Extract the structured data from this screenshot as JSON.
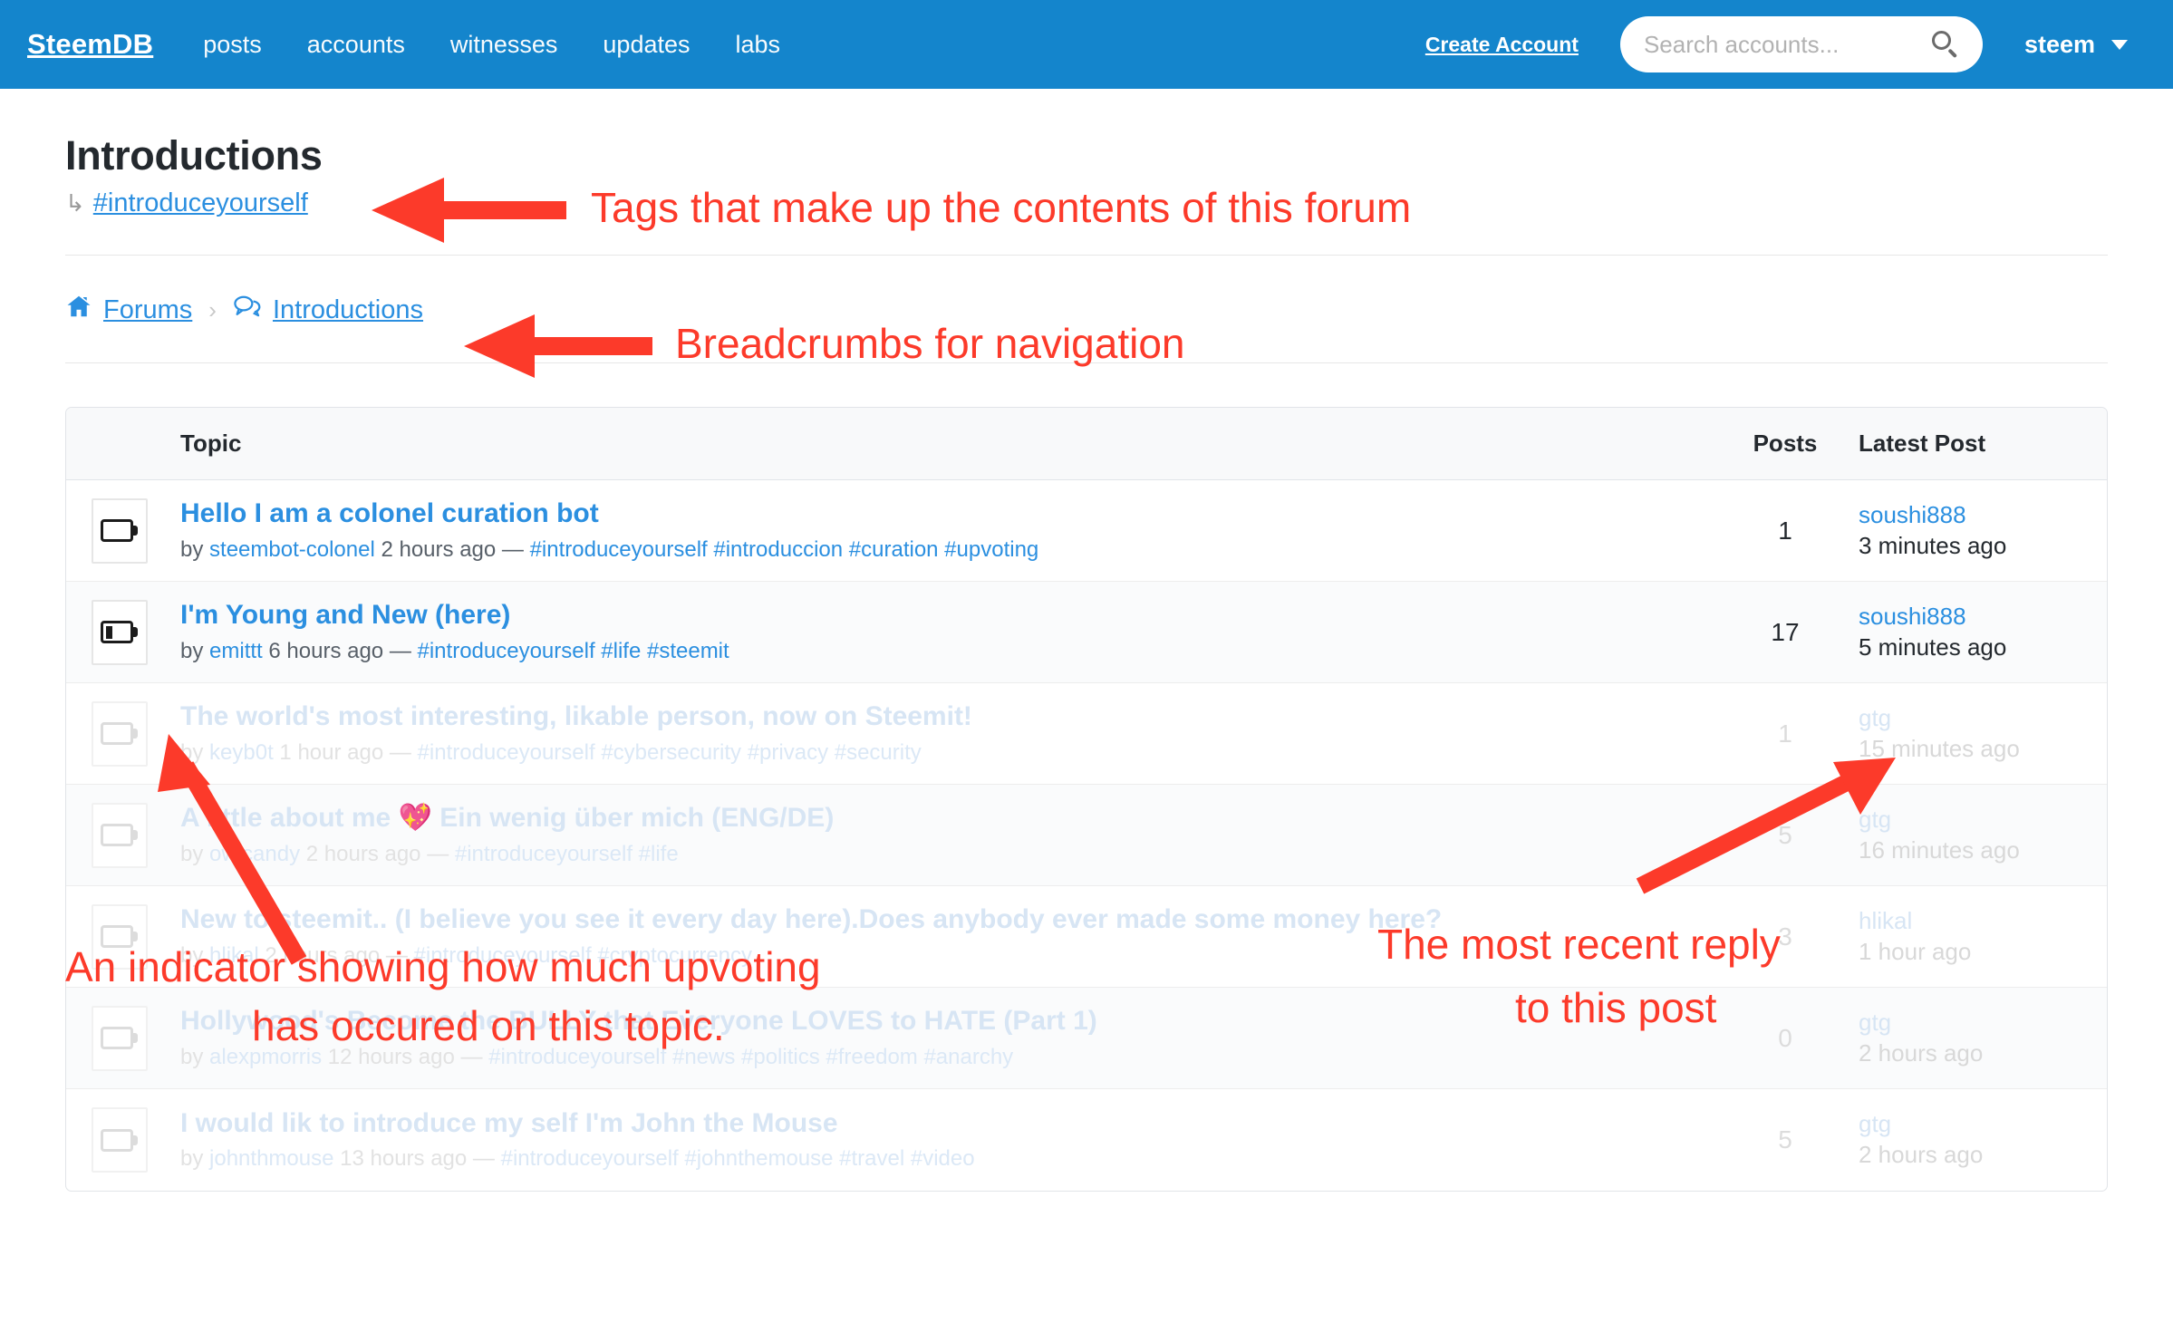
{
  "navbar": {
    "brand": "SteemDB",
    "links": [
      "posts",
      "accounts",
      "witnesses",
      "updates",
      "labs"
    ],
    "create_account": "Create Account",
    "search_placeholder": "Search accounts...",
    "search_value": "",
    "user": "steem",
    "background_color": "#1485cc"
  },
  "header": {
    "title": "Introductions",
    "tag_arrow": "↳",
    "tag": "#introduceyourself"
  },
  "breadcrumbs": {
    "home": "Forums",
    "separator": "›",
    "current": "Introductions"
  },
  "table": {
    "columns": [
      "Topic",
      "Posts",
      "Latest Post"
    ],
    "rows": [
      {
        "battery_level": 0,
        "title": "Hello I am a colonel curation bot",
        "by_label": "by",
        "author": "steembot-colonel",
        "age": "2 hours ago",
        "dash": "—",
        "tags": "#introduceyourself #introduccion #curation #upvoting",
        "posts": "1",
        "latest_user": "soushi888",
        "latest_time": "3 minutes ago",
        "faded": false,
        "alt": false
      },
      {
        "battery_level": 30,
        "title": "I'm Young and New (here)",
        "by_label": "by",
        "author": "emittt",
        "age": "6 hours ago",
        "dash": "—",
        "tags": "#introduceyourself #life #steemit",
        "posts": "17",
        "latest_user": "soushi888",
        "latest_time": "5 minutes ago",
        "faded": false,
        "alt": true
      },
      {
        "battery_level": 0,
        "title": "The world's most interesting, likable person, now on Steemit!",
        "by_label": "by",
        "author": "keyb0t",
        "age": "1 hour ago",
        "dash": "—",
        "tags": "#introduceyourself #cybersecurity #privacy #security",
        "posts": "1",
        "latest_user": "gtg",
        "latest_time": "15 minutes ago",
        "faded": true,
        "alt": false
      },
      {
        "battery_level": 0,
        "title": "A little about me 💖 Ein wenig über mich (ENG/DE)",
        "by_label": "by",
        "author": "owlcandy",
        "age": "2 hours ago",
        "dash": "—",
        "tags": "#introduceyourself #life",
        "posts": "5",
        "latest_user": "gtg",
        "latest_time": "16 minutes ago",
        "faded": true,
        "alt": true
      },
      {
        "battery_level": 0,
        "title": "New to steemit.. (I believe you see it every day here).Does anybody ever made some money here?",
        "by_label": "by",
        "author": "hlikal",
        "age": "2 hours ago",
        "dash": "—",
        "tags": "#introduceyourself #cryptocurrency",
        "posts": "3",
        "latest_user": "hlikal",
        "latest_time": "1 hour ago",
        "faded": true,
        "alt": false
      },
      {
        "battery_level": 0,
        "title": "Hollywood's Become the BULLY that Everyone LOVES to HATE (Part 1)",
        "by_label": "by",
        "author": "alexpmorris",
        "age": "12 hours ago",
        "dash": "—",
        "tags": "#introduceyourself #news #politics #freedom #anarchy",
        "posts": "0",
        "latest_user": "gtg",
        "latest_time": "2 hours ago",
        "faded": true,
        "alt": true
      },
      {
        "battery_level": 0,
        "title": "I would lik to introduce my self I'm John the Mouse",
        "by_label": "by",
        "author": "johnthmouse",
        "age": "13 hours ago",
        "dash": "—",
        "tags": "#introduceyourself #johnthemouse #travel #video",
        "posts": "5",
        "latest_user": "gtg",
        "latest_time": "2 hours ago",
        "faded": true,
        "alt": false
      }
    ]
  },
  "annotations": {
    "color": "#fc3a2a",
    "tags_note": "Tags that make up the contents of this forum",
    "breadcrumb_note": "Breadcrumbs for navigation",
    "battery_note_line1": "An indicator showing how much upvoting",
    "battery_note_line2": "has occured on this topic.",
    "latest_note_line1": "The most recent reply",
    "latest_note_line2": "to this post"
  }
}
